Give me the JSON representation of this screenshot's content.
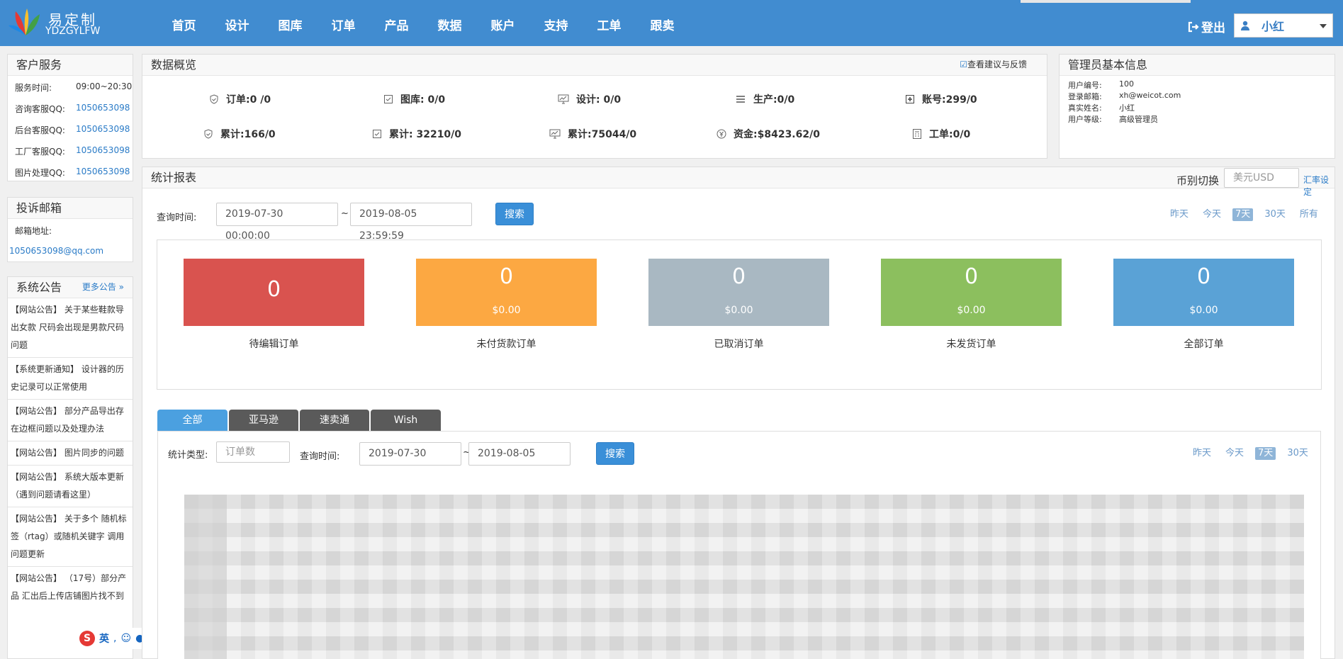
{
  "header": {
    "logo_cn": "易定制",
    "logo_en": "YDZGYLFW",
    "nav": [
      "首页",
      "设计",
      "图库",
      "订单",
      "产品",
      "数据",
      "账户",
      "支持",
      "工单",
      "跟卖"
    ],
    "logout": "登出",
    "user": "小红"
  },
  "customer_service": {
    "title": "客户服务",
    "rows": [
      {
        "label": "服务时间:",
        "value": "09:00~20:30"
      },
      {
        "label": "咨询客服QQ:",
        "value": "1050653098"
      },
      {
        "label": "后台客服QQ:",
        "value": "1050653098"
      },
      {
        "label": "工厂客服QQ:",
        "value": "1050653098"
      },
      {
        "label": "图片处理QQ:",
        "value": "1050653098"
      }
    ]
  },
  "complaint": {
    "title": "投诉邮箱",
    "label": "邮箱地址:",
    "email": "1050653098@qq.com"
  },
  "announcements": {
    "title": "系统公告",
    "more": "更多公告",
    "items": [
      "【网站公告】 关于某些鞋款导出女款 尺码会出现是男款尺码问题",
      "【系统更新通知】 设计器的历史记录可以正常使用",
      "【网站公告】 部分产品导出存在边框问题以及处理办法",
      "【网站公告】 图片同步的问题",
      "【网站公告】 系统大版本更新（遇到问题请看这里）",
      "【网站公告】 关于多个 随机标签（rtag）或随机关键字 调用问题更新",
      "【网站公告】 （17号）部分产品 汇出后上传店铺图片找不到"
    ]
  },
  "overview": {
    "title": "数据概览",
    "feedback": "查看建议与反馈",
    "row1": [
      "订单:0 /0",
      "图库: 0/0",
      "设计: 0/0",
      "生产:0/0",
      "账号:299/0"
    ],
    "row2": [
      "累计:166/0",
      "累计: 32210/0",
      "累计:75044/0",
      "资金:$8423.62/0",
      "工单:0/0"
    ]
  },
  "admin": {
    "title": "管理员基本信息",
    "rows": [
      {
        "label": "用户编号:",
        "value": "100"
      },
      {
        "label": "登录邮箱:",
        "value": "xh@weicot.com"
      },
      {
        "label": "真实姓名:",
        "value": "小红"
      },
      {
        "label": "用户等级:",
        "value": "高级管理员"
      }
    ]
  },
  "report": {
    "title": "统计报表",
    "currency_label": "币别切换",
    "currency_value": "美元USD",
    "rate_link": "汇率设定",
    "query_label": "查询时间:",
    "start": "2019-07-30 00:00:00",
    "sep": "~",
    "end": "2019-08-05 23:59:59",
    "search": "搜索",
    "ranges": [
      "昨天",
      "今天",
      "7天",
      "30天",
      "所有"
    ],
    "active_range": "7天",
    "cards": [
      {
        "num": "0",
        "amount": "",
        "label": "待编辑订单",
        "color": "#d9534f"
      },
      {
        "num": "0",
        "amount": "$0.00",
        "label": "未付货款订单",
        "color": "#fca842"
      },
      {
        "num": "0",
        "amount": "$0.00",
        "label": "已取消订单",
        "color": "#a9b8c2"
      },
      {
        "num": "0",
        "amount": "$0.00",
        "label": "未发货订单",
        "color": "#8cbf5e"
      },
      {
        "num": "0",
        "amount": "$0.00",
        "label": "全部订单",
        "color": "#5aa2d6"
      }
    ]
  },
  "platform": {
    "tabs": [
      "全部",
      "亚马逊",
      "速卖通",
      "Wish"
    ],
    "active_tab": "全部",
    "type_label": "统计类型:",
    "type_placeholder": "订单数",
    "query_label": "查询时间:",
    "start": "2019-07-30",
    "sep": "~",
    "end": "2019-08-05",
    "search": "搜索",
    "ranges": [
      "昨天",
      "今天",
      "7天",
      "30天"
    ],
    "active_range": "7天"
  },
  "ime": {
    "lang": "英"
  }
}
